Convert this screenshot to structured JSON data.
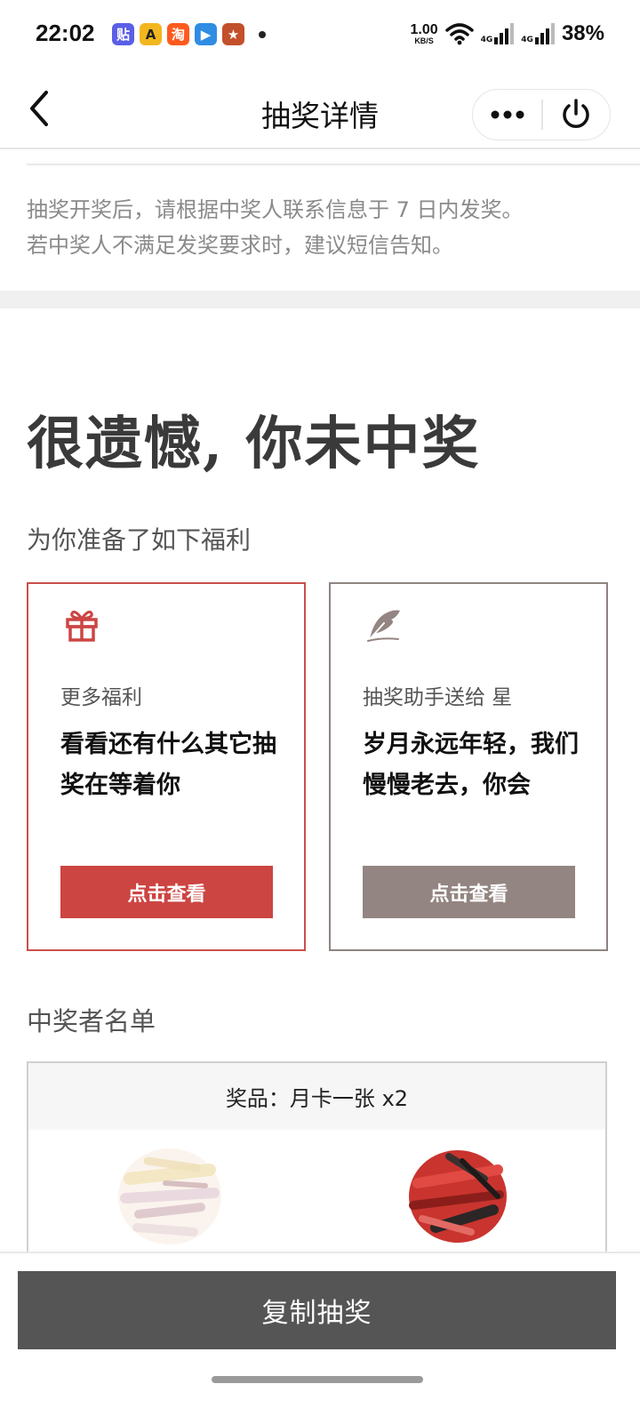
{
  "status_bar": {
    "time": "22:02",
    "net_speed": "1.00",
    "net_unit": "KB/S",
    "signal_label_1": "4G",
    "signal_label_2": "4G",
    "battery": "38%",
    "apps": [
      {
        "icon": "tieba-app-icon",
        "glyph": "贴",
        "color": "#5b5fe6"
      },
      {
        "icon": "app-a-icon",
        "glyph": "A",
        "color": "#f2b61e"
      },
      {
        "icon": "taobao-app-icon",
        "glyph": "淘",
        "color": "#ff5a1e"
      },
      {
        "icon": "video-app-icon",
        "glyph": "▶",
        "color": "#2f8de4"
      },
      {
        "icon": "game-app-icon",
        "glyph": "★",
        "color": "#c2502a"
      }
    ]
  },
  "nav": {
    "title": "抽奖详情",
    "back_icon": "chevron-left-icon",
    "more_icon": "more-dots-icon",
    "close_icon": "power-icon"
  },
  "notice": {
    "line1": "抽奖开奖后，请根据中奖人联系信息于 7 日内发奖。",
    "line2": "若中奖人不满足发奖要求时，建议短信告知。"
  },
  "result": {
    "title": "很遗憾, 你未中奖"
  },
  "benefits": {
    "heading": "为你准备了如下福利",
    "cards": [
      {
        "icon": "gift-icon",
        "label": "更多福利",
        "text": "看看还有什么其它抽奖在等着你",
        "button": "点击查看",
        "accent": "#cc4542"
      },
      {
        "icon": "feather-icon",
        "label": "抽奖助手送给 星",
        "text": "岁月永远年轻，我们慢慢老去，你会",
        "button": "点击查看",
        "accent": "#938581"
      }
    ]
  },
  "winners": {
    "heading": "中奖者名单",
    "prize": "奖品：月卡一张 x2",
    "avatars": [
      "winner-avatar-1",
      "winner-avatar-2"
    ]
  },
  "footer": {
    "copy_button": "复制抽奖"
  }
}
